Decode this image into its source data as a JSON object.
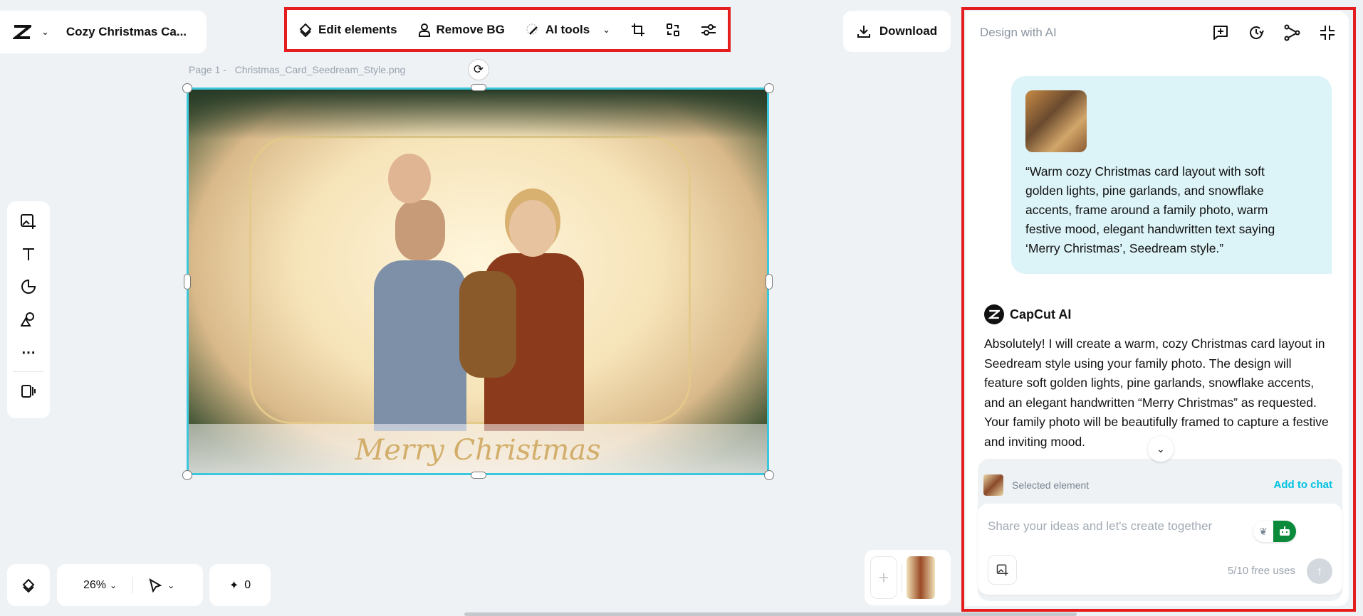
{
  "header": {
    "project_title": "Cozy Christmas Ca...",
    "download_label": "Download"
  },
  "toolbar": {
    "edit_elements": "Edit elements",
    "remove_bg": "Remove BG",
    "ai_tools": "AI tools"
  },
  "canvas": {
    "page_label": "Page 1 -",
    "file_name": "Christmas_Card_Seedream_Style.png",
    "card_text": "Merry Christmas"
  },
  "bottom": {
    "zoom": "26%",
    "credits": "0"
  },
  "panel": {
    "title": "Design with AI",
    "user_message": "“Warm cozy Christmas card layout with soft golden lights, pine garlands, and snowflake accents, frame around a family photo, warm festive mood, elegant handwritten text saying ‘Merry Christmas’, Seedream style.”",
    "ai_name": "CapCut AI",
    "ai_message": "Absolutely! I will create a warm, cozy Christmas card layout in Seedream style using your family photo. The design will feature soft golden lights, pine garlands, snowflake accents, and an elegant handwritten “Merry Christmas” as requested. Your family photo will be beautifully framed to capture a festive and inviting mood.",
    "selected_label": "Selected element",
    "add_to_chat": "Add to chat",
    "input_placeholder": "Share your ideas and let's create together",
    "free_uses": "5/10 free uses"
  },
  "colors": {
    "accent": "#00c2e0",
    "highlight": "#e41e1e",
    "bubble": "#dcf3f7",
    "agent_green": "#0a8a3a"
  }
}
